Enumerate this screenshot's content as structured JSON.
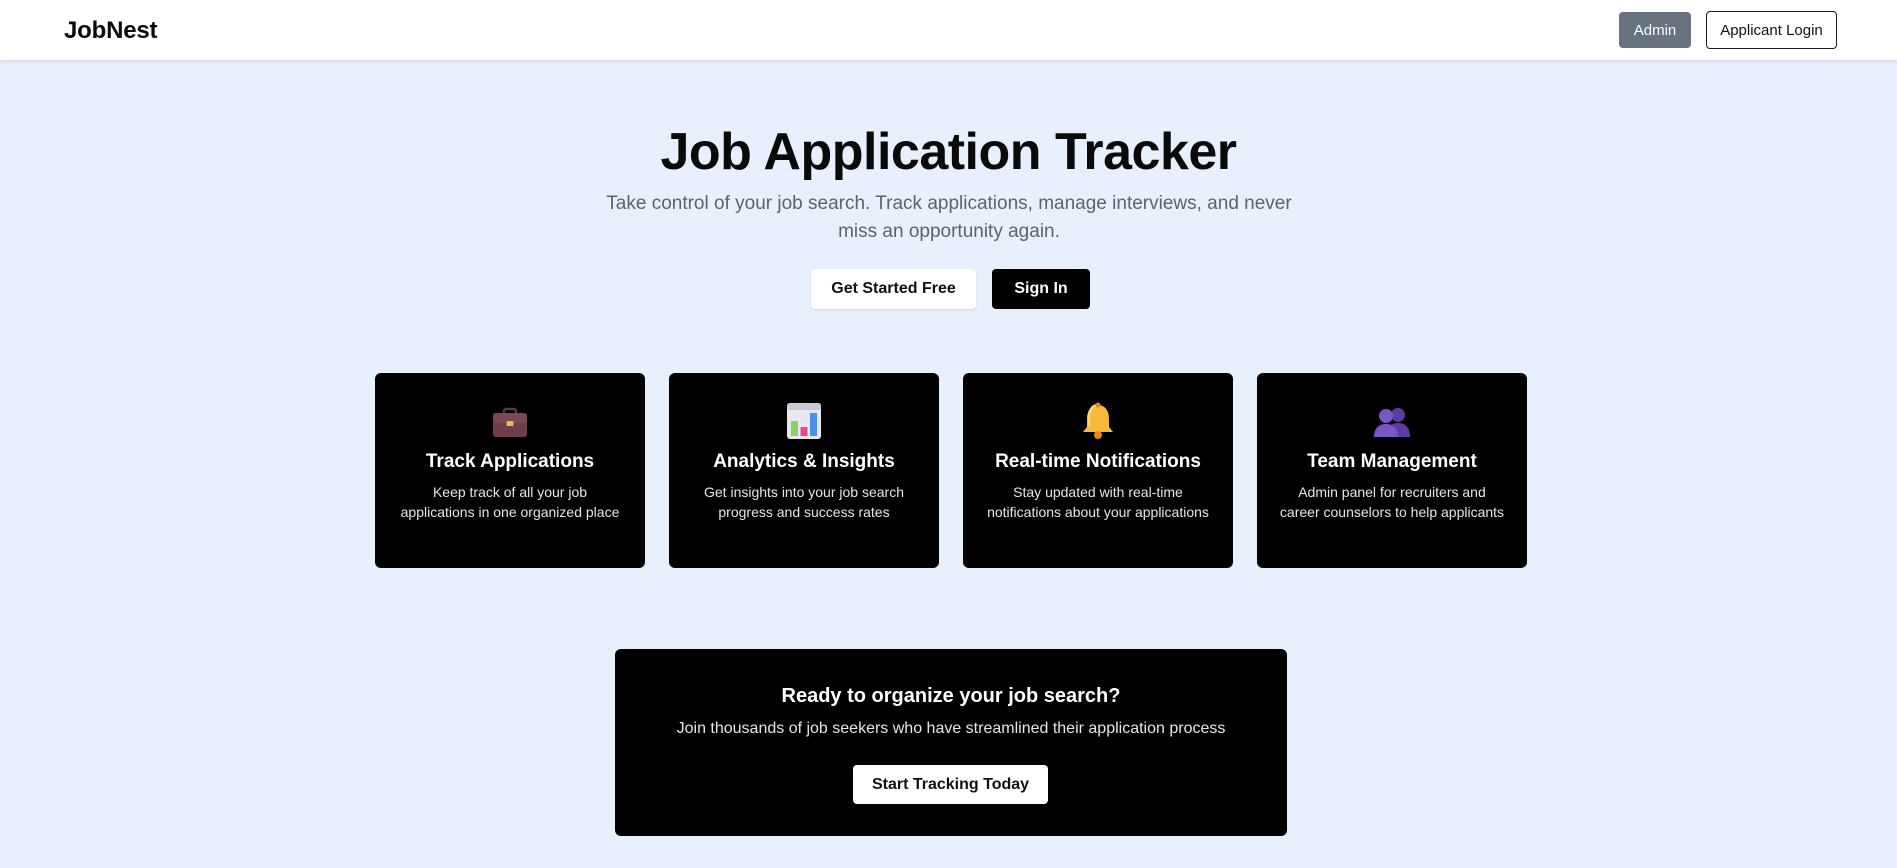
{
  "nav": {
    "brand": "JobNest",
    "admin_label": "Admin",
    "applicant_login_label": "Applicant Login"
  },
  "hero": {
    "title": "Job Application Tracker",
    "subtitle": "Take control of your job search. Track applications, manage interviews, and never miss an opportunity again.",
    "get_started_label": "Get Started Free",
    "sign_in_label": "Sign In"
  },
  "features": [
    {
      "icon": "briefcase-icon",
      "title": "Track Applications",
      "description": "Keep track of all your job applications in one organized place"
    },
    {
      "icon": "bar-chart-icon",
      "title": "Analytics & Insights",
      "description": "Get insights into your job search progress and success rates"
    },
    {
      "icon": "bell-icon",
      "title": "Real-time Notifications",
      "description": "Stay updated with real-time notifications about your applications"
    },
    {
      "icon": "team-icon",
      "title": "Team Management",
      "description": "Admin panel for recruiters and career counselors to help applicants"
    }
  ],
  "cta": {
    "title": "Ready to organize your job search?",
    "subtitle": "Join thousands of job seekers who have streamlined their application process",
    "button_label": "Start Tracking Today"
  },
  "colors": {
    "page_background": "#e8f0fd",
    "card_background": "#000000",
    "admin_button": "#687280"
  }
}
